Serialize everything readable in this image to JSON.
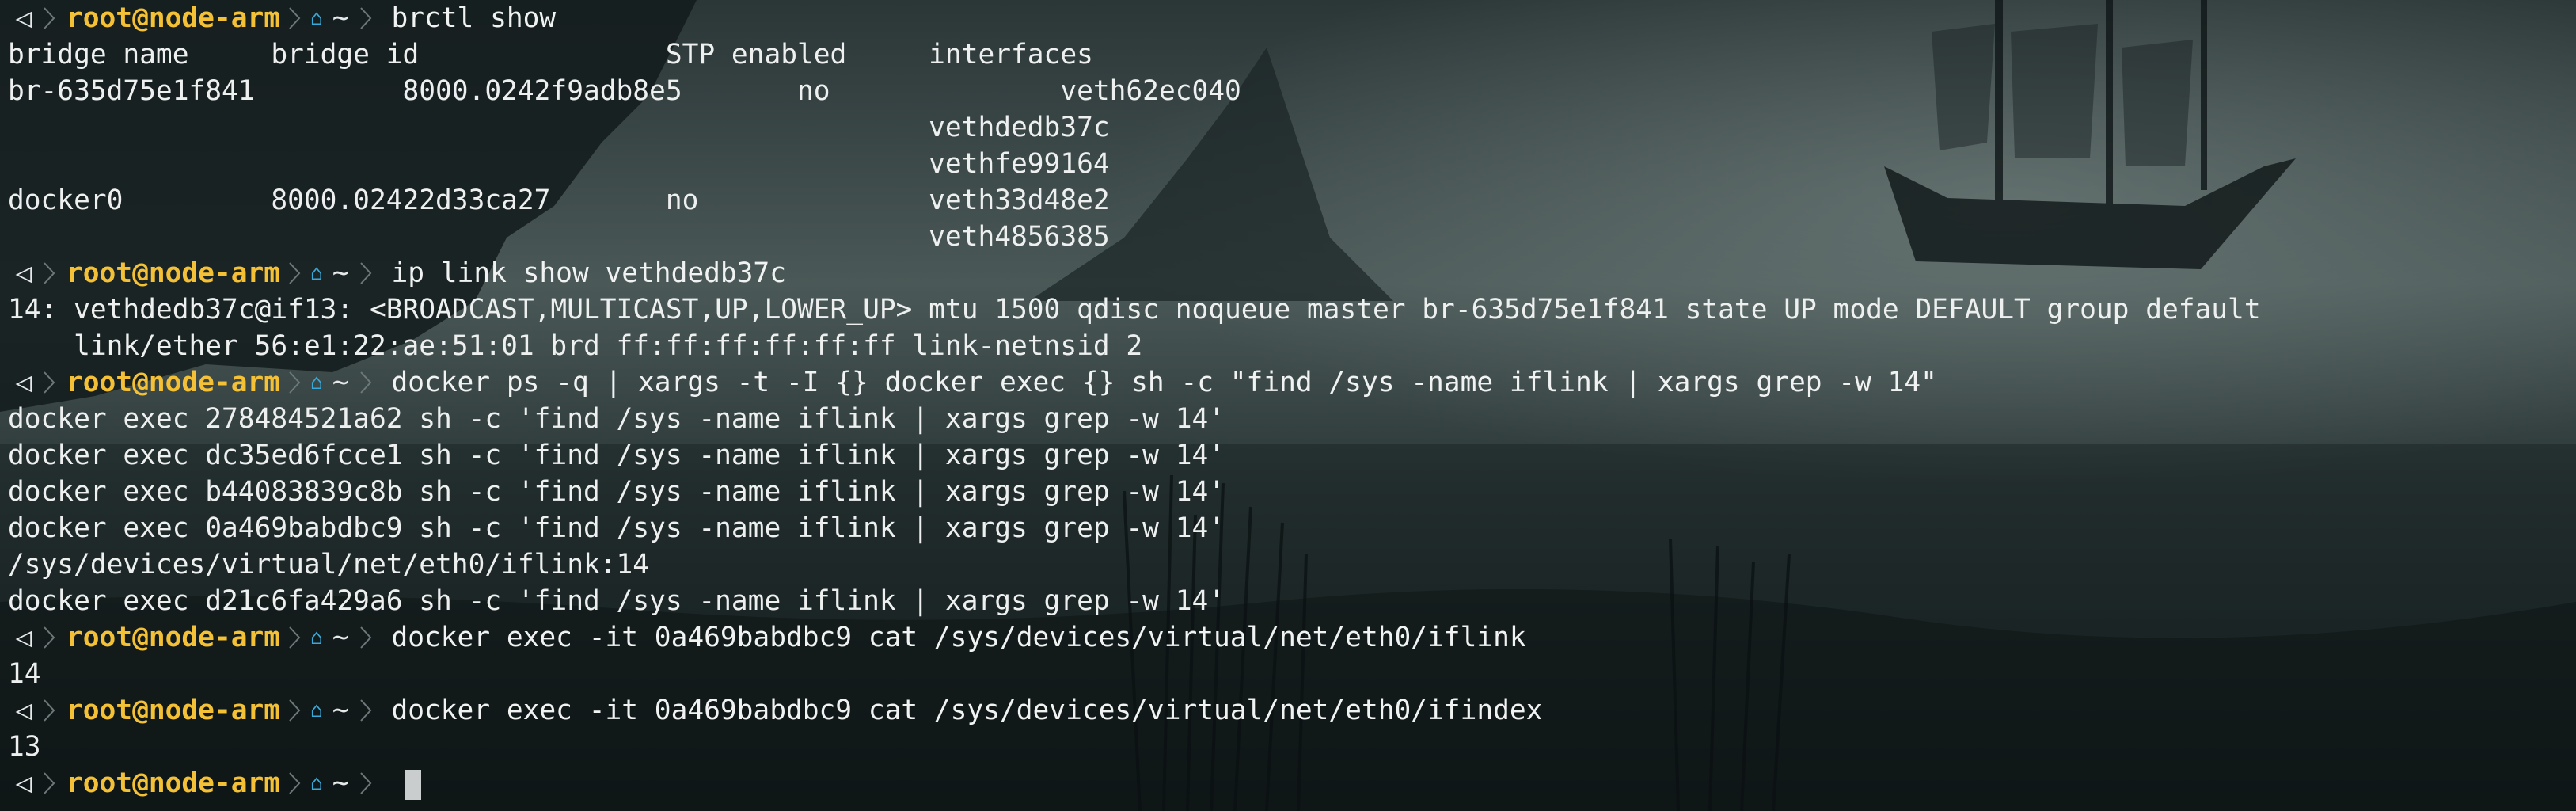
{
  "prompt": {
    "os_icon": "◁",
    "user_host": "root@node-arm",
    "home_icon": "home-icon",
    "cwd": "~"
  },
  "lines": [
    {
      "type": "prompt",
      "cmd": "brctl show"
    },
    {
      "type": "out",
      "text": "bridge name     bridge id               STP enabled     interfaces"
    },
    {
      "type": "out",
      "text": "br-635d75e1f841         8000.0242f9adb8e5       no              veth62ec040"
    },
    {
      "type": "out",
      "text": "                                                        vethdedb37c"
    },
    {
      "type": "out",
      "text": "                                                        vethfe99164"
    },
    {
      "type": "out",
      "text": "docker0         8000.02422d33ca27       no              veth33d48e2"
    },
    {
      "type": "out",
      "text": "                                                        veth4856385"
    },
    {
      "type": "prompt",
      "cmd": "ip link show vethdedb37c"
    },
    {
      "type": "out",
      "text": "14: vethdedb37c@if13: <BROADCAST,MULTICAST,UP,LOWER_UP> mtu 1500 qdisc noqueue master br-635d75e1f841 state UP mode DEFAULT group default"
    },
    {
      "type": "out",
      "text": "    link/ether 56:e1:22:ae:51:01 brd ff:ff:ff:ff:ff:ff link-netnsid 2"
    },
    {
      "type": "prompt",
      "cmd": "docker ps -q | xargs -t -I {} docker exec {} sh -c \"find /sys -name iflink | xargs grep -w 14\""
    },
    {
      "type": "out",
      "text": "docker exec 278484521a62 sh -c 'find /sys -name iflink | xargs grep -w 14'"
    },
    {
      "type": "out",
      "text": "docker exec dc35ed6fcce1 sh -c 'find /sys -name iflink | xargs grep -w 14'"
    },
    {
      "type": "out",
      "text": "docker exec b44083839c8b sh -c 'find /sys -name iflink | xargs grep -w 14'"
    },
    {
      "type": "out",
      "text": "docker exec 0a469babdbc9 sh -c 'find /sys -name iflink | xargs grep -w 14'"
    },
    {
      "type": "out",
      "text": "/sys/devices/virtual/net/eth0/iflink:14"
    },
    {
      "type": "out",
      "text": "docker exec d21c6fa429a6 sh -c 'find /sys -name iflink | xargs grep -w 14'"
    },
    {
      "type": "prompt",
      "cmd": "docker exec -it 0a469babdbc9 cat /sys/devices/virtual/net/eth0/iflink"
    },
    {
      "type": "out",
      "text": "14"
    },
    {
      "type": "prompt",
      "cmd": "docker exec -it 0a469babdbc9 cat /sys/devices/virtual/net/eth0/ifindex"
    },
    {
      "type": "out",
      "text": "13"
    },
    {
      "type": "prompt",
      "cmd": "",
      "cursor": true
    }
  ],
  "colors": {
    "user": "#f4c136",
    "home_icon": "#39a9d9",
    "text": "#eceeee",
    "prompt_segment_bg": "#2a3536",
    "prompt_separator": "#6d7879"
  }
}
